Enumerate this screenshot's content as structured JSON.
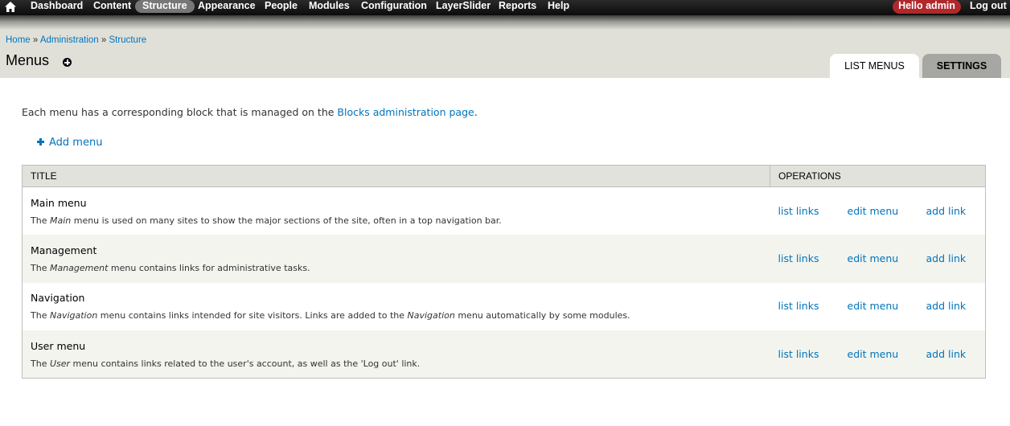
{
  "toolbar": {
    "items": [
      "Dashboard",
      "Content",
      "Structure",
      "Appearance",
      "People",
      "Modules",
      "Configuration",
      "LayerSlider",
      "Reports",
      "Help"
    ],
    "active": "Structure",
    "hello_prefix": "Hello ",
    "username": "admin",
    "logout": "Log out"
  },
  "breadcrumb": {
    "items": [
      "Home",
      "Administration",
      "Structure"
    ],
    "separator": " » "
  },
  "page_title": "Menus",
  "tabs": [
    "List menus",
    "Settings"
  ],
  "help": {
    "text": "Each menu has a corresponding block that is managed on the ",
    "link": "Blocks administration page",
    "suffix": "."
  },
  "add_menu": "Add menu",
  "table": {
    "headers": [
      "Title",
      "Operations"
    ],
    "rows": [
      {
        "title": "Main menu",
        "desc_pre": "The ",
        "desc_em": "Main",
        "desc_post": " menu is used on many sites to show the major sections of the site, often in a top navigation bar."
      },
      {
        "title": "Management",
        "desc_pre": "The ",
        "desc_em": "Management",
        "desc_post": " menu contains links for administrative tasks."
      },
      {
        "title": "Navigation",
        "desc_pre": "The ",
        "desc_em": "Navigation",
        "desc_post": " menu contains links intended for site visitors. Links are added to the ",
        "desc_em2": "Navigation",
        "desc_post2": " menu automatically by some modules."
      },
      {
        "title": "User menu",
        "desc_pre": "The ",
        "desc_em": "User",
        "desc_post": " menu contains links related to the user's account, as well as the 'Log out' link."
      }
    ],
    "operations": [
      "list links",
      "edit menu",
      "add link"
    ]
  }
}
